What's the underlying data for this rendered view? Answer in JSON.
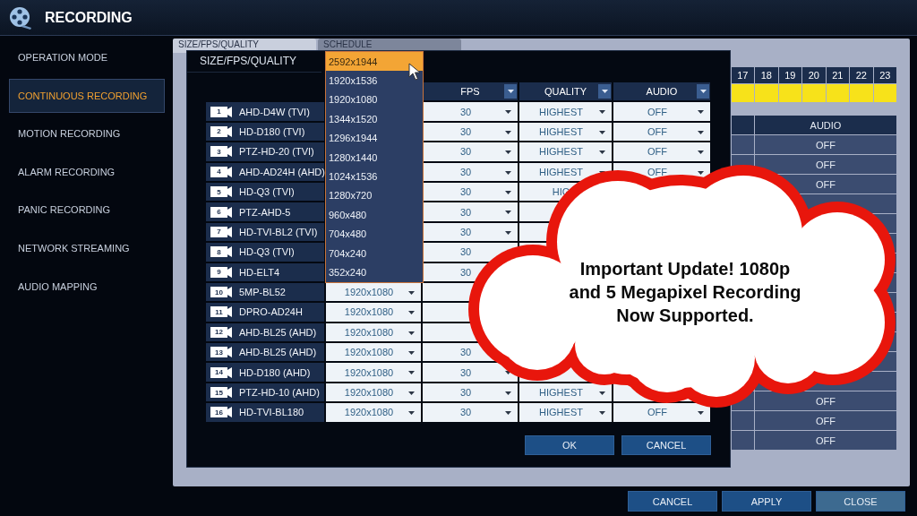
{
  "window": {
    "title": "RECORDING"
  },
  "sidebar": {
    "items": [
      {
        "label": "OPERATION MODE",
        "selected": false
      },
      {
        "label": "CONTINUOUS RECORDING",
        "selected": true
      },
      {
        "label": "MOTION RECORDING",
        "selected": false
      },
      {
        "label": "ALARM RECORDING",
        "selected": false
      },
      {
        "label": "PANIC RECORDING",
        "selected": false
      },
      {
        "label": "NETWORK STREAMING",
        "selected": false
      },
      {
        "label": "AUDIO MAPPING",
        "selected": false
      }
    ]
  },
  "tabs": [
    {
      "label": "SIZE/FPS/QUALITY",
      "selected": true
    },
    {
      "label": "SCHEDULE",
      "selected": false
    }
  ],
  "schedule": {
    "hours": [
      {
        "label": "17",
        "recording": true
      },
      {
        "label": "18",
        "recording": true
      },
      {
        "label": "19",
        "recording": true
      },
      {
        "label": "20",
        "recording": true
      },
      {
        "label": "21",
        "recording": true
      },
      {
        "label": "22",
        "recording": true
      },
      {
        "label": "23",
        "recording": true
      }
    ]
  },
  "audio_table": {
    "header": "AUDIO",
    "rows_top": [
      "OFF",
      "OFF",
      "OFF"
    ],
    "rows_bottom": [
      "OFF",
      "OFF",
      "OFF"
    ]
  },
  "dialog": {
    "title": "SIZE/FPS/QUALITY",
    "columns": [
      "FPS",
      "QUALITY",
      "AUDIO"
    ],
    "rows": [
      {
        "number": "1",
        "name": "AHD-D4W (TVI)",
        "fps": "30",
        "quality": "HIGHEST",
        "audio": "OFF"
      },
      {
        "number": "2",
        "name": "HD-D180 (TVI)",
        "fps": "30",
        "quality": "HIGHEST",
        "audio": "OFF"
      },
      {
        "number": "3",
        "name": "PTZ-HD-20 (TVI)",
        "fps": "30",
        "quality": "HIGHEST",
        "audio": "OFF"
      },
      {
        "number": "4",
        "name": "AHD-AD24H (AHD)",
        "fps": "30",
        "quality": "HIGHEST",
        "audio": "OFF"
      },
      {
        "number": "5",
        "name": "HD-Q3 (TVI)",
        "fps": "30",
        "quality": "HIG"
      },
      {
        "number": "6",
        "name": "PTZ-AHD-5",
        "fps": "30"
      },
      {
        "number": "7",
        "name": "HD-TVI-BL2 (TVI)",
        "fps": "30"
      },
      {
        "number": "8",
        "name": "HD-Q3 (TVI)",
        "fps": "30"
      },
      {
        "number": "9",
        "name": "HD-ELT4",
        "fps": "30"
      },
      {
        "number": "10",
        "name": "5MP-BL52",
        "size": "1920x1080"
      },
      {
        "number": "11",
        "name": "DPRO-AD24H",
        "size": "1920x1080"
      },
      {
        "number": "12",
        "name": "AHD-BL25 (AHD)",
        "size": "1920x1080"
      },
      {
        "number": "13",
        "name": "AHD-BL25 (AHD)",
        "size": "1920x1080",
        "fps": "30"
      },
      {
        "number": "14",
        "name": "HD-D180 (AHD)",
        "size": "1920x1080",
        "fps": "30"
      },
      {
        "number": "15",
        "name": "PTZ-HD-10 (AHD)",
        "size": "1920x1080",
        "fps": "30",
        "quality": "HIGHEST"
      },
      {
        "number": "16",
        "name": "HD-TVI-BL180",
        "size": "1920x1080",
        "fps": "30",
        "quality": "HIGHEST",
        "audio": "OFF"
      }
    ],
    "size_options": [
      {
        "label": "2592x1944",
        "selected": true
      },
      {
        "label": "1920x1536",
        "selected": false
      },
      {
        "label": "1920x1080",
        "selected": false
      },
      {
        "label": "1344x1520",
        "selected": false
      },
      {
        "label": "1296x1944",
        "selected": false
      },
      {
        "label": "1280x1440",
        "selected": false
      },
      {
        "label": "1024x1536",
        "selected": false
      },
      {
        "label": "1280x720",
        "selected": false
      },
      {
        "label": "960x480",
        "selected": false
      },
      {
        "label": "704x480",
        "selected": false
      },
      {
        "label": "704x240",
        "selected": false
      },
      {
        "label": "352x240",
        "selected": false
      }
    ],
    "buttons": [
      "OK",
      "CANCEL"
    ]
  },
  "callout": {
    "lines": [
      "Important Update! 1080p",
      "and 5 Megapixel Recording",
      "Now Supported."
    ]
  },
  "footer_buttons": [
    {
      "label": "CANCEL",
      "kind": "normal"
    },
    {
      "label": "APPLY",
      "kind": "normal"
    },
    {
      "label": "CLOSE",
      "kind": "close"
    }
  ]
}
